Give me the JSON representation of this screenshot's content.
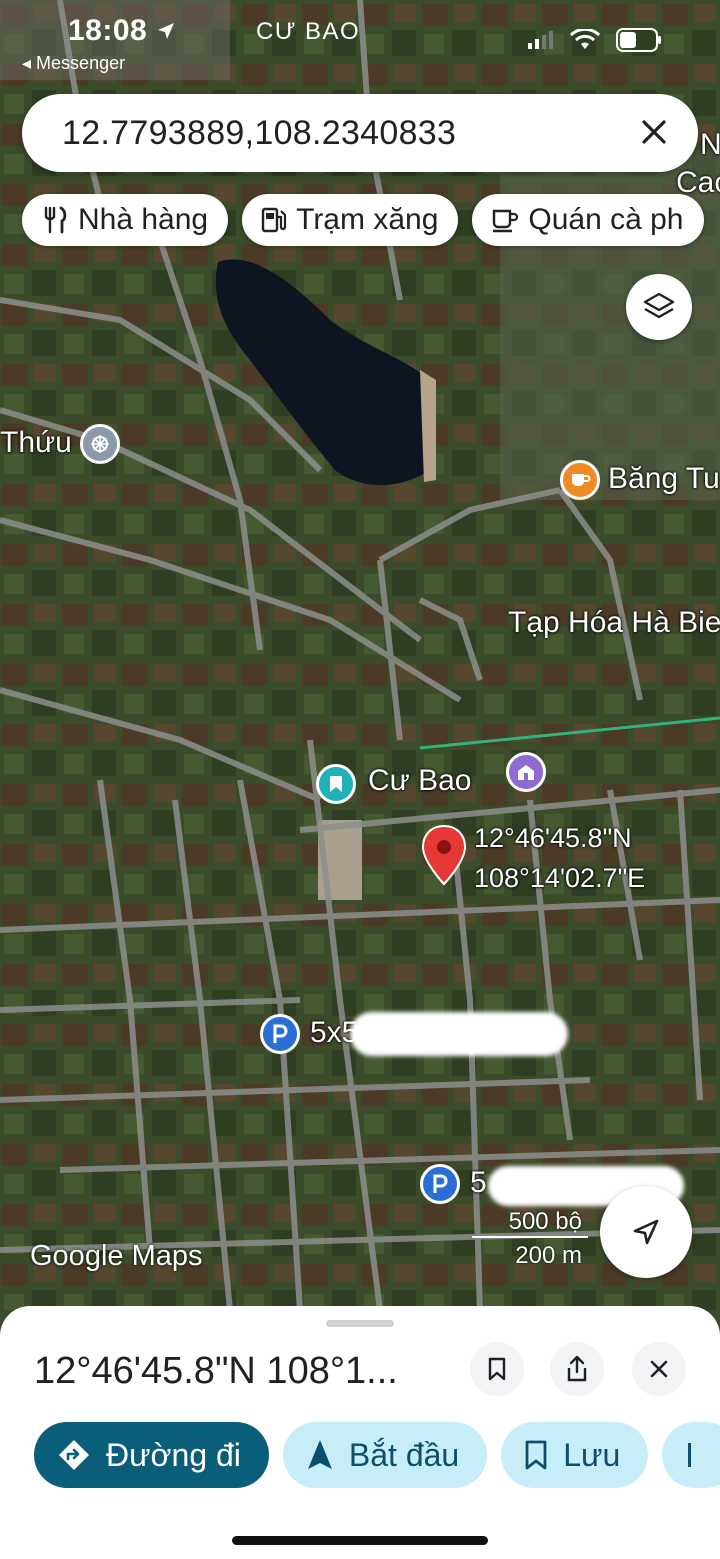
{
  "status_bar": {
    "time": "18:08",
    "back_app": "Messenger",
    "place": "CƯ BAO"
  },
  "search": {
    "query": "12.7793889,108.2340833"
  },
  "chips": [
    {
      "icon": "fork-knife-icon",
      "label": "Nhà hàng"
    },
    {
      "icon": "gas-pump-icon",
      "label": "Trạm xăng"
    },
    {
      "icon": "coffee-cup-icon",
      "label": "Quán cà ph"
    }
  ],
  "map": {
    "labels": {
      "thuu": "Thứu",
      "bang_tu": "Băng Tu",
      "tap_hoa": "Tạp Hóa Hà Bie",
      "cu_bao": "Cư Bao",
      "parking1": "5x5",
      "parking2": "5",
      "corner_n": "N",
      "corner_cao": "Cao"
    },
    "pin": {
      "lat": "12°46'45.8\"N",
      "lng": "108°14'02.7\"E"
    },
    "logo": "Google Maps",
    "scale": {
      "imperial": "500 bộ",
      "metric": "200 m"
    }
  },
  "sheet": {
    "title": "12°46'45.8\"N 108°1...",
    "actions": [
      {
        "icon": "directions-icon",
        "label": "Đường đi"
      },
      {
        "icon": "navigation-arrow-icon",
        "label": "Bắt đầu"
      },
      {
        "icon": "bookmark-icon",
        "label": "Lưu"
      }
    ]
  },
  "colors": {
    "accent": "#0b5e7a",
    "pin": "#e53935",
    "chip_bg": "#ffffff"
  }
}
